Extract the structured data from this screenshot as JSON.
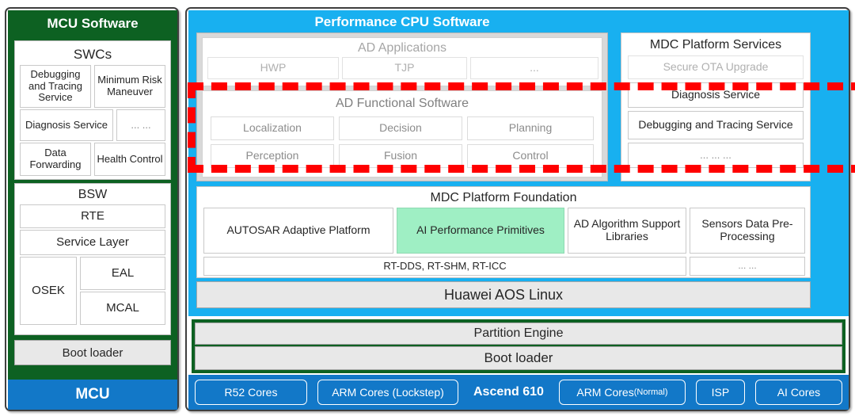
{
  "colors": {
    "green": "#0d6122",
    "blue_header": "#18b0f0",
    "blue_hw": "#1278c8",
    "mint": "#9FEFC4",
    "gray_card": "#d9d9d9",
    "highlight_red": "#ff0000"
  },
  "mcu": {
    "title": "MCU Software",
    "swcs": {
      "title": "SWCs",
      "items": [
        "Debugging and Tracing Service",
        "Minimum Risk Maneuver",
        "Diagnosis Service",
        "... ...",
        "Data Forwarding",
        "Health Control"
      ]
    },
    "bsw": {
      "title": "BSW",
      "rte": "RTE",
      "service_layer": "Service Layer",
      "osek": "OSEK",
      "eal": "EAL",
      "mcal": "MCAL"
    },
    "boot_loader": "Boot loader",
    "footer": "MCU"
  },
  "perf": {
    "title": "Performance CPU Software",
    "ad_applications": {
      "title": "AD Applications",
      "items": [
        "HWP",
        "TJP",
        "..."
      ]
    },
    "ad_functional_software": {
      "title": "AD Functional Software",
      "items": [
        "Localization",
        "Decision",
        "Planning",
        "Perception",
        "Fusion",
        "Control"
      ]
    },
    "mdc_platform_services": {
      "title": "MDC  Platform Services",
      "items": [
        "Secure OTA Upgrade",
        "Diagnosis Service",
        "Debugging and Tracing Service",
        "... ... ..."
      ]
    },
    "mdc_platform_foundation": {
      "title": "MDC  Platform Foundation",
      "items": [
        "AUTOSAR Adaptive Platform",
        "AI Performance Primitives",
        "AD Algorithm Support Libraries",
        "Sensors Data Pre-Processing"
      ],
      "rt_row": "RT-DDS, RT-SHM, RT-ICC",
      "rt_more": "... ..."
    },
    "aos_linux": "Huawei AOS Linux",
    "partition_engine": "Partition Engine",
    "boot_loader": "Boot loader",
    "hardware": [
      {
        "label": "R52 Cores",
        "style": "pill"
      },
      {
        "label": "ARM Cores (Lockstep)",
        "style": "pill"
      },
      {
        "label": "Ascend 610",
        "style": "plain"
      },
      {
        "label": "ARM Cores (Normal)",
        "style": "pill-mixed",
        "main": "ARM Cores ",
        "paren": "(Normal)"
      },
      {
        "label": "ISP",
        "style": "pill"
      },
      {
        "label": "AI Cores",
        "style": "pill"
      }
    ]
  }
}
